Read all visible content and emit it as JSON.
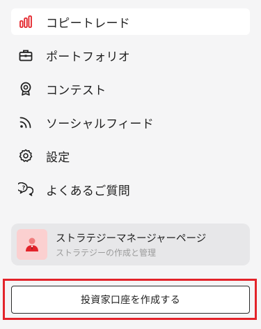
{
  "menu": {
    "items": [
      {
        "label": "コピートレード",
        "icon": "bar-chart-icon",
        "active": true
      },
      {
        "label": "ポートフォリオ",
        "icon": "briefcase-icon",
        "active": false
      },
      {
        "label": "コンテスト",
        "icon": "medal-icon",
        "active": false
      },
      {
        "label": "ソーシャルフィード",
        "icon": "rss-feed-icon",
        "active": false
      },
      {
        "label": "設定",
        "icon": "gear-icon",
        "active": false
      },
      {
        "label": "よくあるご質問",
        "icon": "faq-chat-icon",
        "active": false
      }
    ]
  },
  "manager_card": {
    "title": "ストラテジーマネージャーページ",
    "subtitle": "ストラテジーの作成と管理",
    "icon": "manager-avatar-icon"
  },
  "cta": {
    "label": "投資家口座を作成する"
  },
  "colors": {
    "accent": "#e3232a",
    "background": "#f5f5f6",
    "card_background": "#e7e7e9",
    "avatar_background": "#fbd0d0",
    "subtle_text": "#9b9b9b"
  }
}
